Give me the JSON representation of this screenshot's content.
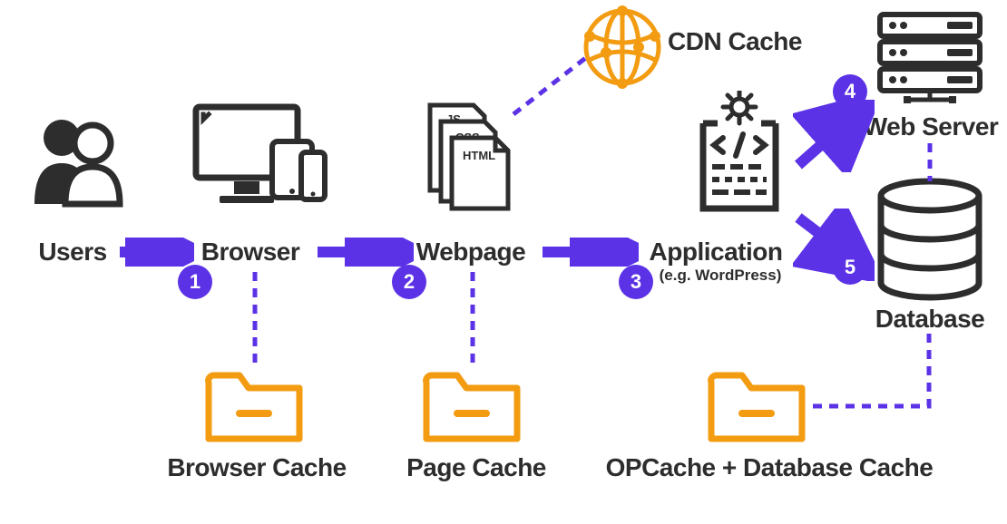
{
  "nodes": {
    "users": {
      "label": "Users"
    },
    "browser": {
      "label": "Browser"
    },
    "webpage": {
      "label": "Webpage"
    },
    "application": {
      "label": "Application",
      "sublabel": "(e.g. WordPress)"
    },
    "webserver": {
      "label": "Web Server"
    },
    "database": {
      "label": "Database"
    },
    "cdn": {
      "label": "CDN Cache"
    }
  },
  "caches": {
    "browser": {
      "label": "Browser Cache"
    },
    "page": {
      "label": "Page Cache"
    },
    "opdb": {
      "label": "OPCache + Database Cache"
    }
  },
  "files": {
    "js": "JS",
    "css": "CSS",
    "html": "HTML"
  },
  "badges": {
    "b1": "1",
    "b2": "2",
    "b3": "3",
    "b4": "4",
    "b5": "5"
  },
  "colors": {
    "accent": "#5b32e6",
    "cache": "#f39c12",
    "dark": "#2d2d2d"
  }
}
